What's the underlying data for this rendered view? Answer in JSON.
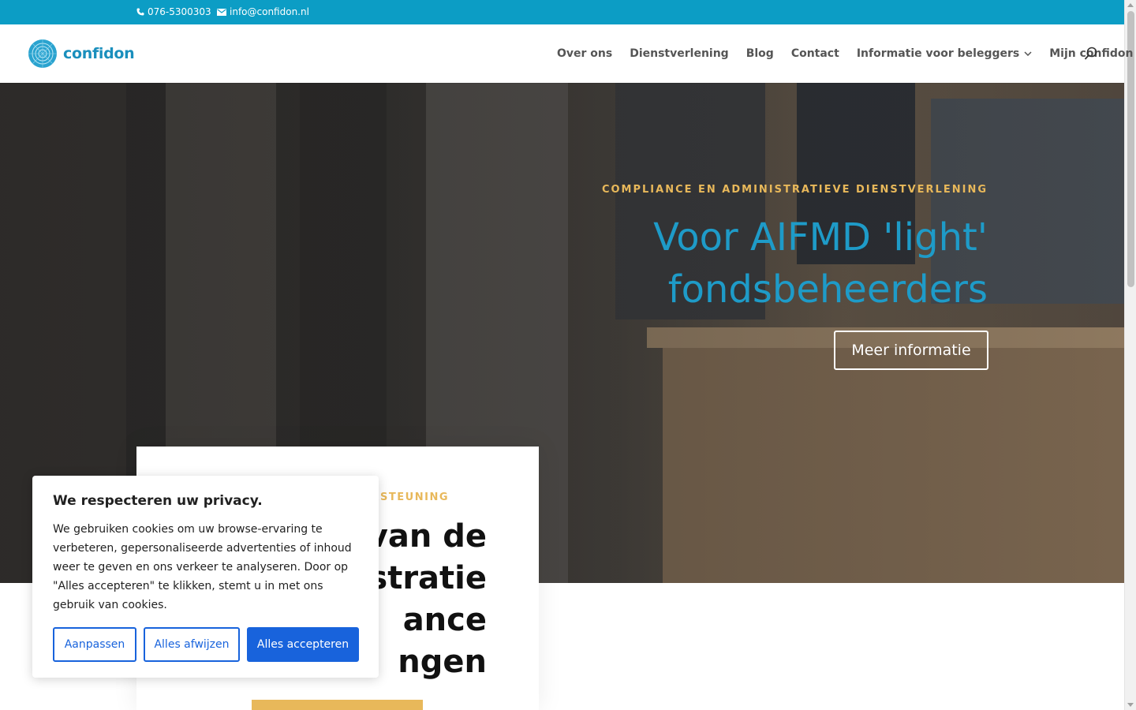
{
  "topbar": {
    "phone": "076-5300303",
    "email": "info@confidon.nl",
    "background_color": "#0c9dc5"
  },
  "header": {
    "logo_text": "confidon",
    "nav": [
      {
        "label": "Over ons"
      },
      {
        "label": "Dienstverlening"
      },
      {
        "label": "Blog"
      },
      {
        "label": "Contact"
      },
      {
        "label": "Informatie voor beleggers",
        "has_dropdown": true
      },
      {
        "label": "Mijn confidon"
      }
    ],
    "search_icon": "search-icon"
  },
  "hero": {
    "eyebrow": "COMPLIANCE EN ADMINISTRATIEVE DIENSTVERLENING",
    "title_line1": "Voor AIFMD 'light'",
    "title_line2": "fondsbeheerders",
    "button_label": "Meer informatie",
    "accent_color": "#1e9bc8",
    "eyebrow_color": "#e8b85a"
  },
  "card": {
    "eyebrow_visible": "RSTEUNING",
    "title_lines": [
      "van de",
      "istratie",
      "ance",
      "ngen"
    ]
  },
  "cookie": {
    "title": "We respecteren uw privacy.",
    "text": "We gebruiken cookies om uw browse-ervaring te verbeteren, gepersonaliseerde advertenties of inhoud weer te geven en ons verkeer te analyseren. Door op \"Alles accepteren\" te klikken, stemt u in met ons gebruik van cookies.",
    "btn_customize": "Aanpassen",
    "btn_reject": "Alles afwijzen",
    "btn_accept": "Alles accepteren",
    "button_color": "#1863dc"
  }
}
